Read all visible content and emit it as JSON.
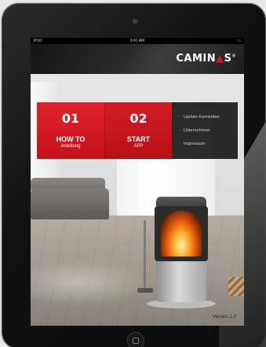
{
  "statusbar": {
    "carrier": "iPod",
    "time": "9:41 AM",
    "battery": ""
  },
  "brand": {
    "logo_text_a": "CAMIN",
    "logo_flame": "🔥",
    "logo_text_b": "S",
    "registered": "®"
  },
  "tiles": [
    {
      "number": "01",
      "title": "HOW TO",
      "subtitle": "Anleitung"
    },
    {
      "number": "02",
      "title": "START",
      "subtitle": "APP"
    }
  ],
  "links": [
    {
      "label": "Update Kaminöfen",
      "arrow": "›"
    },
    {
      "label": "Unternehmen",
      "arrow": "›"
    },
    {
      "label": "Impressum",
      "arrow": "›"
    }
  ],
  "version": "Version 1.0",
  "colors": {
    "accent_red": "#d6151f",
    "tile_red": "#c4121b",
    "dark_panel": "#191919"
  }
}
